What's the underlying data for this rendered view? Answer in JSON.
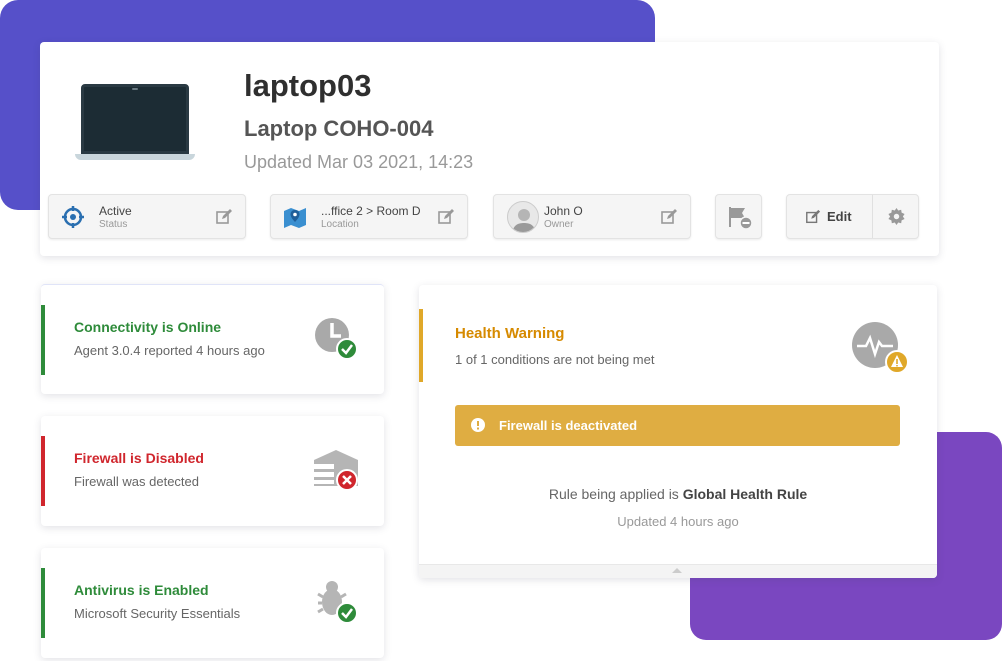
{
  "device": {
    "name": "laptop03",
    "model": "Laptop COHO-004",
    "updated": "Updated Mar 03 2021, 14:23"
  },
  "chips": {
    "status": {
      "title": "Active",
      "sub": "Status"
    },
    "location": {
      "title": "...ffice 2 > Room D",
      "sub": "Location"
    },
    "owner": {
      "title": "John O",
      "sub": "Owner"
    },
    "edit_label": "Edit"
  },
  "status_cards": [
    {
      "title": "Connectivity is Online",
      "sub": "Agent 3.0.4 reported 4 hours ago",
      "color": "#2e8b3a",
      "icon": "clock-check-icon"
    },
    {
      "title": "Firewall is Disabled",
      "sub": "Firewall was detected",
      "color": "#d0262d",
      "icon": "firewall-x-icon"
    },
    {
      "title": "Antivirus is Enabled",
      "sub": "Microsoft Security Essentials",
      "color": "#2e8b3a",
      "icon": "bug-check-icon"
    }
  ],
  "health": {
    "title": "Health Warning",
    "sub": "1 of 1 conditions are not being met",
    "alert": "Firewall is deactivated",
    "rule_prefix": "Rule being applied is",
    "rule_name": "Global Health Rule",
    "updated": "Updated 4 hours ago",
    "accent": "#e0a829"
  },
  "colors": {
    "deco_top": "#5650c9",
    "deco_bottom": "#7a47c0",
    "success": "#2e8b3a",
    "danger": "#d0262d",
    "warning": "#dfad42"
  }
}
